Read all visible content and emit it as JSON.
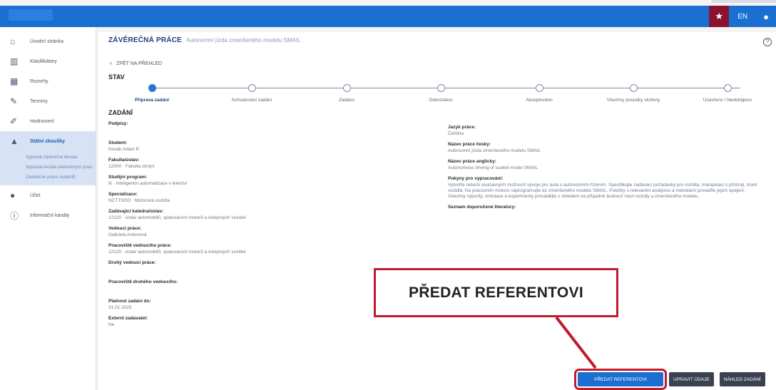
{
  "header": {
    "lang": "EN",
    "star_icon": "star-icon",
    "user_icon": "user-icon",
    "accent": "#1a6fd0"
  },
  "sidebar": {
    "items": [
      {
        "label": "Úvodní stránka",
        "icon": "home-icon"
      },
      {
        "label": "Klasifikátory",
        "icon": "book-icon"
      },
      {
        "label": "Rozvrhy",
        "icon": "calendar-icon"
      },
      {
        "label": "Termíny",
        "icon": "pen-icon"
      },
      {
        "label": "Hodnocení",
        "icon": "pencil-icon"
      },
      {
        "label": "Státní zkoušky",
        "icon": "graduation-icon"
      },
      {
        "label": "Účet",
        "icon": "person-icon"
      },
      {
        "label": "Informační kanály",
        "icon": "info-icon"
      }
    ],
    "subitems": [
      "Vypsané závěrečné témata",
      "Vypsaná témata závěrečných prací",
      "Závěrečné práce studentů"
    ]
  },
  "page": {
    "title": "ZÁVĚREČNÁ PRÁCE",
    "subtitle": "Autonomní jízda zmenšeného modelu SMAIL",
    "back": "ZPĚT NA PŘEHLED",
    "stav": "STAV",
    "zadani": "ZADÁNÍ"
  },
  "steps": [
    {
      "label": "Příprava zadání",
      "done": true
    },
    {
      "label": "Schvalování zadání",
      "done": false
    },
    {
      "label": "Zadáno",
      "done": false
    },
    {
      "label": "Odevzdáno",
      "done": false
    },
    {
      "label": "Akceptováno",
      "done": false
    },
    {
      "label": "Všechny posudky vloženy",
      "done": false
    },
    {
      "label": "Uzavřeno / Neobhájeno",
      "done": false
    }
  ],
  "left_fields": [
    {
      "k": "Podpisy:",
      "v": ""
    },
    {
      "k": "Student:",
      "v": "Novák Adam P."
    },
    {
      "k": "Fakulta/ústav:",
      "v": "12000 · Fakulta strojní"
    },
    {
      "k": "Studijní program:",
      "v": "N · Inteligentní automatizace v letectví"
    },
    {
      "k": "Specializace:",
      "v": "NCTTNSD · Motorová vozidla"
    },
    {
      "k": "Zadávající katedra/ústav:",
      "v": "12120 · ústav automobilů, spalovacích motorů a kolejových vozidel"
    },
    {
      "k": "Vedoucí práce:",
      "v": "Gabriela Antonová"
    },
    {
      "k": "Pracoviště vedoucího práce:",
      "v": "12120 · ústav automobilů, spalovacích motorů a kolejových vozidel"
    },
    {
      "k": "Druhý vedoucí práce:",
      "v": ""
    },
    {
      "k": "Pracoviště druhého vedoucího:",
      "v": ""
    },
    {
      "k": "Platnost zadání do:",
      "v": "31.01.2025"
    },
    {
      "k": "Externí zadavatel:",
      "v": "Ne"
    }
  ],
  "right_fields": [
    {
      "k": "Jazyk práce:",
      "v": "Čeština"
    },
    {
      "k": "Název práce česky:",
      "v": "Autonomní jízda zmenšeného modelu SMAIL"
    },
    {
      "k": "Název práce anglicky:",
      "v": "Autonomous driving of scaled model SMAIL"
    },
    {
      "k": "Pokyny pro vypracování:",
      "v": "Vytvořte rešerši současných možností vývoje pro auta s autonomním řízením. Specifikujte zadávací požadavky pro vozidla, manipulaci s přístroji, hraní vozidla. Na pracovním motoru naprogramujte do zmenšeného modelu SMAIL. Položky s relevantní analýzou a metodami proveďte jejich spojení. Všechny výpočty, simulace a experimenty provádějte s ohledem na případné budoucí mezi vozidly a zmenšeného modelu."
    },
    {
      "k": "Seznam doporučené literatury:",
      "v": ""
    }
  ],
  "buttons": {
    "submit": "PŘEDAT REFERENTOVI",
    "edit": "UPRAVIT ÚDAJE",
    "preview": "NÁHLED ZADÁNÍ"
  },
  "callout": {
    "text": "PŘEDAT REFERENTOVI",
    "color": "#c01a2e"
  }
}
